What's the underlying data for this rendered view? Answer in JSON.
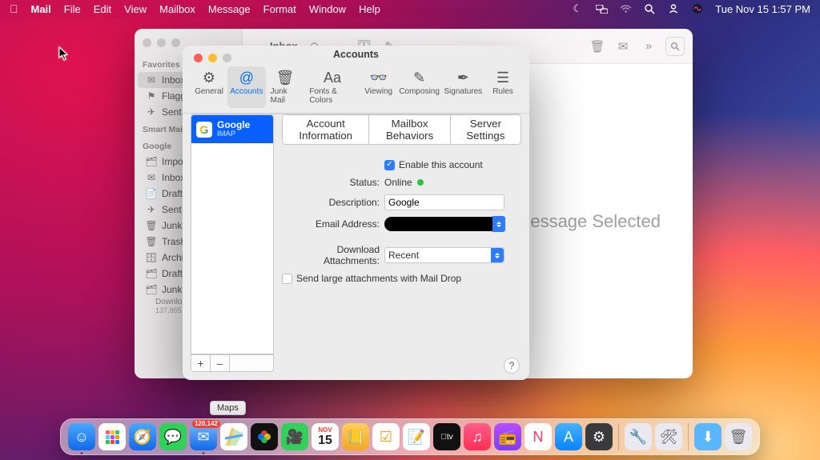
{
  "menubar": {
    "app": "Mail",
    "items": [
      "File",
      "Edit",
      "View",
      "Mailbox",
      "Message",
      "Format",
      "Window",
      "Help"
    ],
    "clock": "Tue Nov 15  1:57 PM"
  },
  "mail_window": {
    "title": "Inbox",
    "no_selection": "No Message Selected",
    "sections": {
      "favorites": "Favorites",
      "smart": "Smart Mailboxes",
      "google": "Google"
    },
    "fav_items": [
      "Inbox",
      "Flagged",
      "Sent"
    ],
    "google_items": [
      "Important",
      "Inbox",
      "Drafts",
      "Sent",
      "Junk",
      "Trash",
      "Archive",
      "Drafts",
      "Junk"
    ],
    "downloading": "Downloading",
    "downloading_count": "137,865"
  },
  "pref": {
    "title": "Accounts",
    "tabs": [
      "General",
      "Accounts",
      "Junk Mail",
      "Fonts & Colors",
      "Viewing",
      "Composing",
      "Signatures",
      "Rules"
    ],
    "account": {
      "name": "Google",
      "protocol": "IMAP"
    },
    "segments": [
      "Account Information",
      "Mailbox Behaviors",
      "Server Settings"
    ],
    "enable_label": "Enable this account",
    "status_label": "Status:",
    "status_value": "Online",
    "description_label": "Description:",
    "description_value": "Google",
    "email_label": "Email Address:",
    "download_label": "Download Attachments:",
    "download_value": "Recent",
    "maildrop_label": "Send large attachments with Mail Drop",
    "add": "+",
    "remove": "–",
    "help": "?"
  },
  "dock": {
    "tooltip": "Maps",
    "mail_badge": "120,142",
    "cal_day": "15",
    "cal_month": "NOV"
  }
}
